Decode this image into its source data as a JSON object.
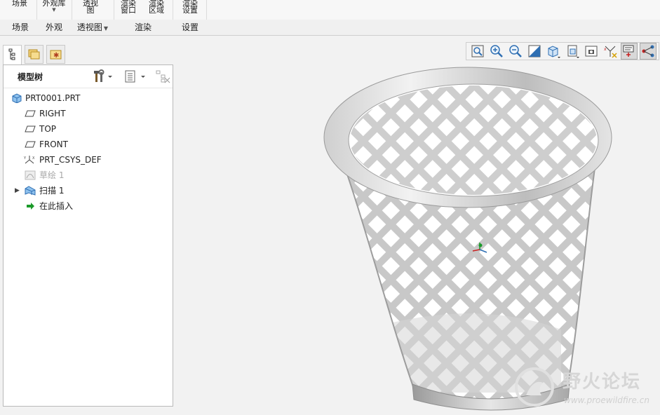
{
  "ribbon": {
    "buttons": {
      "scene": "场景",
      "appearance_gallery": "外观库",
      "perspective_1": "透视",
      "perspective_2": "图",
      "render_window_1": "渲染",
      "render_window_2": "窗口",
      "render_region_1": "渲染",
      "render_region_2": "区域",
      "render_setup_1": "渲染",
      "render_setup_2": "设置"
    },
    "groups": {
      "scene": "场景",
      "appearance": "外观",
      "perspective": "透视图",
      "render": "渲染",
      "settings": "设置"
    }
  },
  "model_tree": {
    "title": "模型树",
    "items": [
      {
        "label": "PRT0001.PRT",
        "icon": "part-icon"
      },
      {
        "label": "RIGHT",
        "icon": "datum-plane-icon"
      },
      {
        "label": "TOP",
        "icon": "datum-plane-icon"
      },
      {
        "label": "FRONT",
        "icon": "datum-plane-icon"
      },
      {
        "label": "PRT_CSYS_DEF",
        "icon": "coordinate-system-icon"
      },
      {
        "label": "草绘 1",
        "icon": "sketch-icon",
        "dimmed": true
      },
      {
        "label": "扫描 1",
        "icon": "sweep-icon",
        "expandable": true
      },
      {
        "label": "在此插入",
        "icon": "insert-here-arrow-icon"
      }
    ]
  },
  "view_toolbar": {
    "buttons": [
      "refit-icon",
      "zoom-in-icon",
      "zoom-out-icon",
      "repaint-icon",
      "display-style-icon",
      "saved-orientations-icon",
      "view-manager-icon",
      "datum-display-icon",
      "annotation-display-icon",
      "spin-center-icon"
    ]
  },
  "watermark": {
    "title": "野火论坛",
    "url": "www.proewildfire.cn"
  },
  "colors": {
    "accent": "#2f6fb3",
    "insert_arrow": "#1b9a2a",
    "model_gray": "#c8c8c8"
  }
}
